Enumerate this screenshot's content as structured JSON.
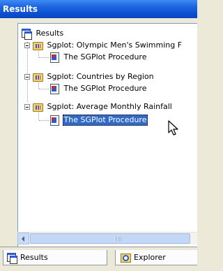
{
  "window": {
    "title": "Results"
  },
  "tree": {
    "root": {
      "label": "Results",
      "icon": "results-window-icon"
    },
    "groups": [
      {
        "label": "Sgplot:  Olympic Men's Swimming F",
        "icon": "procedure-folder-icon",
        "children": [
          {
            "label": "The SGPlot Procedure",
            "icon": "output-icon"
          }
        ]
      },
      {
        "label": "Sgplot:  Countries by Region",
        "icon": "procedure-folder-icon",
        "children": [
          {
            "label": "The SGPlot Procedure",
            "icon": "output-icon"
          }
        ]
      },
      {
        "label": "Sgplot:  Average Monthly Rainfall",
        "icon": "procedure-folder-icon",
        "children": [
          {
            "label": "The SGPlot Procedure",
            "icon": "output-icon",
            "selected": true
          }
        ]
      }
    ]
  },
  "scrollbar": {
    "grip": "|||"
  },
  "tabs": [
    {
      "label": "Results",
      "icon": "results-window-icon",
      "active": true
    },
    {
      "label": "Explorer",
      "icon": "explorer-icon",
      "active": false
    }
  ],
  "colors": {
    "title_bar": "#0b4fd0",
    "selection": "#316ac5",
    "tree_border": "#7f9db9"
  }
}
